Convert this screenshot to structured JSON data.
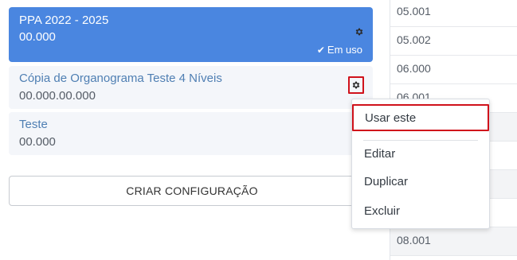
{
  "configurations": [
    {
      "title": "PPA 2022 - 2025",
      "code": "00.000",
      "status": "Em uso"
    },
    {
      "title": "Cópia de Organograma Teste 4 Níveis",
      "code": "00.000.00.000"
    },
    {
      "title": "Teste",
      "code": "00.000"
    }
  ],
  "create_button_label": "CRIAR CONFIGURAÇÃO",
  "context_menu": {
    "items": [
      "Usar este",
      "Editar",
      "Duplicar",
      "Excluir"
    ]
  },
  "code_column": [
    "05.001",
    "05.002",
    "06.000",
    "06.001",
    "",
    "",
    "",
    "",
    "08.001"
  ],
  "icons": {
    "settings": "gear-icon",
    "in_use": "check-icon"
  },
  "colors": {
    "active_card": "#4a86e0",
    "highlight": "#d0121b",
    "link_text": "#4f7fb3"
  }
}
